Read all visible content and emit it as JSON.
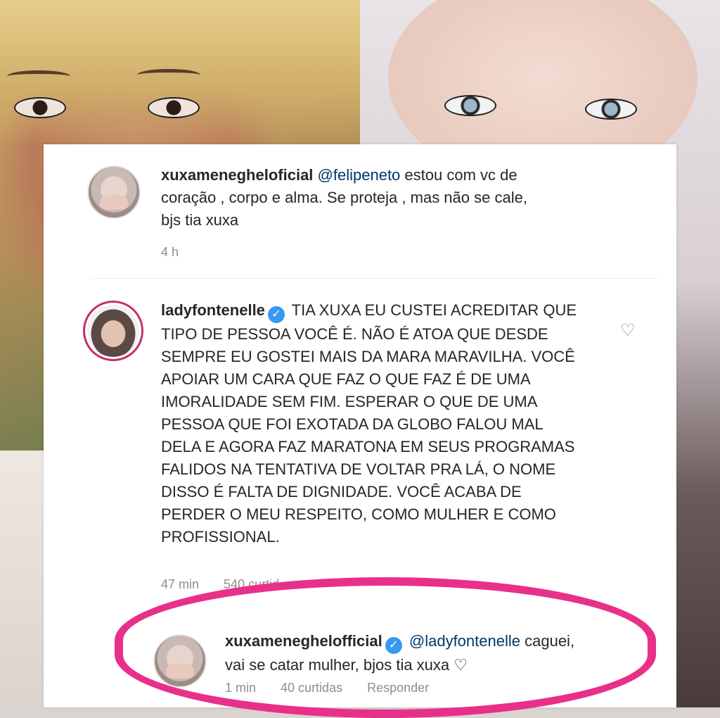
{
  "comments": [
    {
      "username": "xuxameneghelоficial",
      "mention": "@felipeneto",
      "lines": [
        "estou com vc de",
        "coração , corpo e alma. Se proteja , mas não se cale,",
        "bjs tia xuxa"
      ],
      "time": "4 h"
    },
    {
      "username": "ladyfontenelle",
      "lines": [
        "TIA XUXA EU CUSTEI ACREDITAR QUE",
        "TIPO DE  PESSOA VOCÊ É. NÃO É ATOA QUE DESDE",
        "SEMPRE EU GOSTEI MAIS DA MARA MARAVILHA.  VOCÊ",
        "APOIAR UM CARA QUE FAZ O QUE FAZ É DE UMA",
        "IMORALIDADE SEM FIM. ESPERAR O QUE DE UMA",
        "PESSOA QUE FOI EXOTADA DA GLOBO FALOU MAL",
        "DELA E AGORA FAZ MARATONA EM SEUS PROGRAMAS",
        "FALIDOS NA TENTATIVA DE VOLTAR PRA LÁ, O NOME",
        "DISSO É FALTA DE DIGNIDADE. VOCÊ ACABA DE",
        "PERDER O MEU RESPEITO, COMO MULHER E COMO",
        "PROFISSIONAL."
      ],
      "time": "47 min",
      "likes": "540 curtid"
    },
    {
      "username": "xuxameneghelofficial",
      "mention": "@ladyfontenelle",
      "lines": [
        "caguei,",
        "vai se catar mulher, bjos tia xuxa ♡"
      ],
      "time": "1 min",
      "likes": "40 curtidas",
      "reply": "Responder"
    }
  ],
  "icons": {
    "verified": "✓",
    "heart": "♡"
  },
  "colors": {
    "highlight": "#e8308a",
    "verified": "#3897f0",
    "mention": "#00376b",
    "meta": "#8e8e8e"
  }
}
